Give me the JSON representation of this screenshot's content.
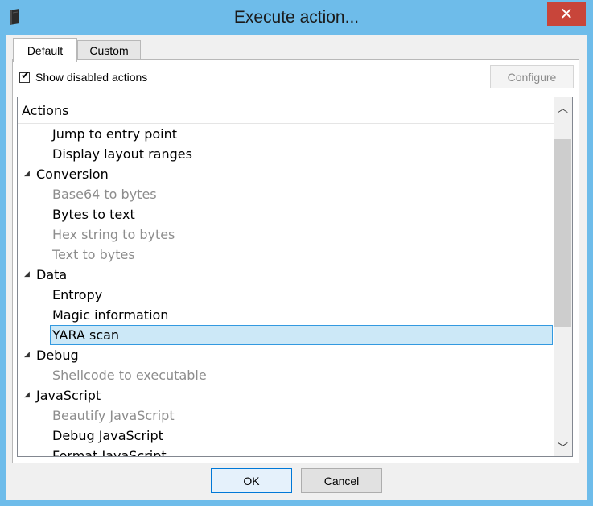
{
  "window": {
    "title": "Execute action..."
  },
  "tabs": [
    {
      "label": "Default"
    },
    {
      "label": "Custom"
    }
  ],
  "options": {
    "show_disabled_label": "Show disabled actions",
    "show_disabled_checked": true,
    "configure_label": "Configure"
  },
  "tree": {
    "header": "Actions",
    "rows": [
      {
        "label": "Jump to entry point",
        "kind": "item",
        "disabled": false
      },
      {
        "label": "Display layout ranges",
        "kind": "item",
        "disabled": false
      },
      {
        "label": "Conversion",
        "kind": "group"
      },
      {
        "label": "Base64 to bytes",
        "kind": "item",
        "disabled": true
      },
      {
        "label": "Bytes to text",
        "kind": "item",
        "disabled": false
      },
      {
        "label": "Hex string to bytes",
        "kind": "item",
        "disabled": true
      },
      {
        "label": "Text to bytes",
        "kind": "item",
        "disabled": true
      },
      {
        "label": "Data",
        "kind": "group"
      },
      {
        "label": "Entropy",
        "kind": "item",
        "disabled": false
      },
      {
        "label": "Magic information",
        "kind": "item",
        "disabled": false
      },
      {
        "label": "YARA scan",
        "kind": "item",
        "disabled": false,
        "selected": true
      },
      {
        "label": "Debug",
        "kind": "group"
      },
      {
        "label": "Shellcode to executable",
        "kind": "item",
        "disabled": true
      },
      {
        "label": "JavaScript",
        "kind": "group"
      },
      {
        "label": "Beautify JavaScript",
        "kind": "item",
        "disabled": true
      },
      {
        "label": "Debug JavaScript",
        "kind": "item",
        "disabled": false
      },
      {
        "label": "Format JavaScript",
        "kind": "item",
        "disabled": false
      }
    ]
  },
  "buttons": {
    "ok": "OK",
    "cancel": "Cancel"
  },
  "colors": {
    "titlebar": "#6ebcea",
    "close": "#c8453a",
    "selection": "#cce8f7",
    "selection_border": "#3399e0",
    "disabled_text": "#8d8d8d"
  }
}
